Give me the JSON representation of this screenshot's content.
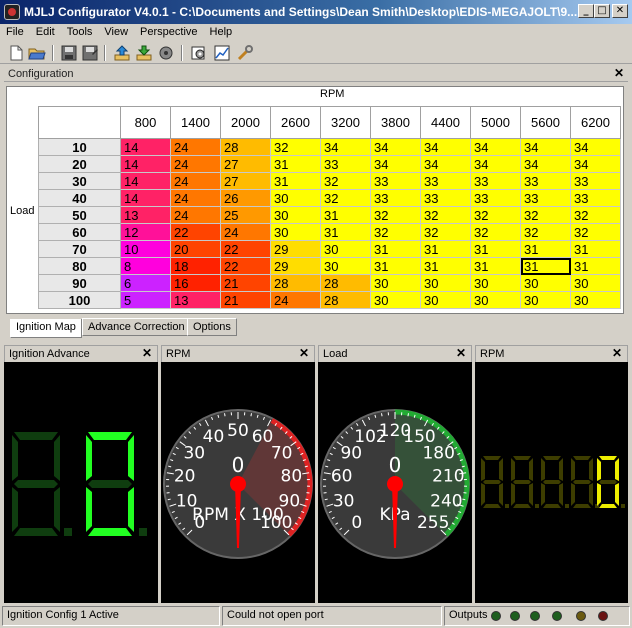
{
  "window": {
    "title": "MJLJ Configurator V4.0.1 - C:\\Documents and Settings\\Dean Smith\\Desktop\\EDIS-MEGAJOLT\\9...",
    "minimize": "_",
    "maximize": "□",
    "close": "✕"
  },
  "menu": [
    "File",
    "Edit",
    "Tools",
    "View",
    "Perspective",
    "Help"
  ],
  "toolbar": {
    "icons": [
      "new-file-icon",
      "open-folder-icon",
      "save-icon",
      "save-as-icon",
      "upload-icon",
      "download-icon",
      "connect-icon",
      "settings-icon",
      "chart-icon",
      "tools-icon"
    ]
  },
  "config": {
    "title": "Configuration",
    "close": "✕",
    "rpm_label": "RPM",
    "load_label": "Load",
    "rpm_bins": [
      "800",
      "1400",
      "2000",
      "2600",
      "3200",
      "3800",
      "4400",
      "5000",
      "5600",
      "6200"
    ],
    "load_bins": [
      "10",
      "20",
      "30",
      "40",
      "50",
      "60",
      "70",
      "80",
      "90",
      "100"
    ],
    "rows": [
      [
        "14",
        "24",
        "28",
        "32",
        "34",
        "34",
        "34",
        "34",
        "34",
        "34"
      ],
      [
        "14",
        "24",
        "27",
        "31",
        "33",
        "34",
        "34",
        "34",
        "34",
        "34"
      ],
      [
        "14",
        "24",
        "27",
        "31",
        "32",
        "33",
        "33",
        "33",
        "33",
        "33"
      ],
      [
        "14",
        "24",
        "26",
        "30",
        "32",
        "33",
        "33",
        "33",
        "33",
        "33"
      ],
      [
        "13",
        "24",
        "25",
        "30",
        "31",
        "32",
        "32",
        "32",
        "32",
        "32"
      ],
      [
        "12",
        "22",
        "24",
        "30",
        "31",
        "32",
        "32",
        "32",
        "32",
        "32"
      ],
      [
        "10",
        "20",
        "22",
        "29",
        "30",
        "31",
        "31",
        "31",
        "31",
        "31"
      ],
      [
        "8",
        "18",
        "22",
        "29",
        "30",
        "31",
        "31",
        "31",
        "31",
        "31"
      ],
      [
        "6",
        "16",
        "21",
        "28",
        "28",
        "30",
        "30",
        "30",
        "30",
        "30"
      ],
      [
        "5",
        "13",
        "21",
        "24",
        "28",
        "30",
        "30",
        "30",
        "30",
        "30"
      ]
    ],
    "selected_cell": {
      "row": 7,
      "col": 8
    },
    "tabs": [
      "Ignition Map",
      "Advance Correction",
      "Options"
    ],
    "active_tab": 0
  },
  "gauges": {
    "ignition_advance": {
      "title": "Ignition Advance",
      "close": "✕",
      "digits": "0.0",
      "color": "#22ff22"
    },
    "rpm_dial": {
      "title": "RPM",
      "close": "✕",
      "ticks": [
        "0",
        "10",
        "20",
        "30",
        "40",
        "50",
        "60",
        "70",
        "80",
        "90",
        "100"
      ],
      "unit": "RPM X 100",
      "value": 0,
      "zero_top": "0"
    },
    "load_dial": {
      "title": "Load",
      "close": "✕",
      "ticks": [
        "0",
        "30",
        "60",
        "90",
        "102",
        "120",
        "150",
        "180",
        "210",
        "240",
        "255"
      ],
      "unit": "KPa",
      "value": 0,
      "zero_top": "0"
    },
    "rpm_digital": {
      "title": "RPM",
      "close": "✕",
      "digits": "8888",
      "lit_digit": "0",
      "color": "#eeee00"
    }
  },
  "status": {
    "config_status": "Ignition Config 1 Active",
    "port_status": "Could not open port",
    "outputs_label": "Outputs",
    "leds": [
      "#1f5f1f",
      "#1f5f1f",
      "#1f5f1f",
      "#1f5f1f",
      "#6b5a10",
      "#6a1212"
    ]
  },
  "colors": {
    "magenta": "#ff00ff",
    "red": "#ff2a00",
    "orange": "#ff8c00",
    "yellow": "#ffff00"
  }
}
